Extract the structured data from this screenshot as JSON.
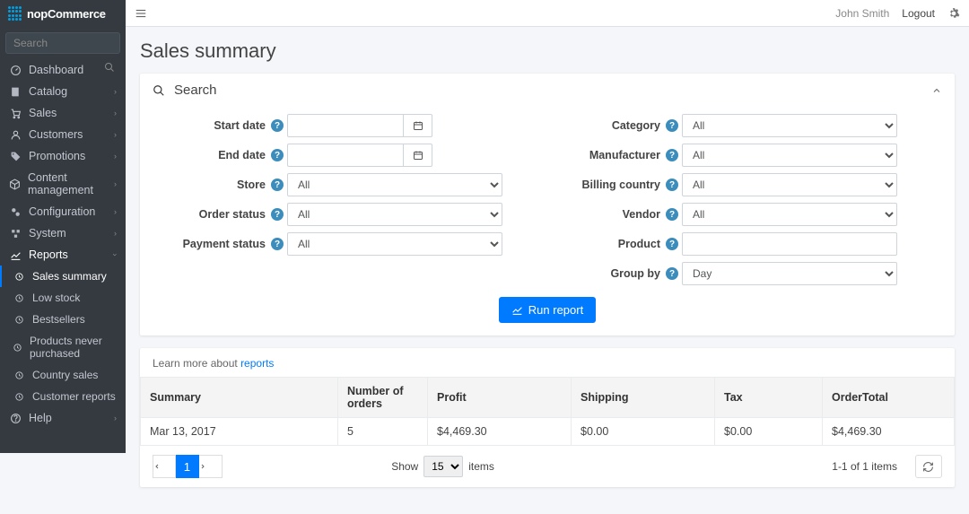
{
  "brand": "nopCommerce",
  "search_placeholder": "Search",
  "user": "John Smith",
  "logout": "Logout",
  "page_title": "Sales summary",
  "sidebar": {
    "items": [
      {
        "label": "Dashboard",
        "icon": "gauge"
      },
      {
        "label": "Catalog",
        "icon": "book",
        "caret": true
      },
      {
        "label": "Sales",
        "icon": "cart",
        "caret": true
      },
      {
        "label": "Customers",
        "icon": "user",
        "caret": true
      },
      {
        "label": "Promotions",
        "icon": "tag",
        "caret": true
      },
      {
        "label": "Content management",
        "icon": "cube",
        "caret": true
      },
      {
        "label": "Configuration",
        "icon": "cogs",
        "caret": true
      },
      {
        "label": "System",
        "icon": "cubes",
        "caret": true
      },
      {
        "label": "Reports",
        "icon": "chart",
        "caret": true,
        "open": true
      },
      {
        "label": "Help",
        "icon": "help",
        "caret": true
      }
    ],
    "reports_sub": [
      {
        "label": "Sales summary",
        "active": true
      },
      {
        "label": "Low stock"
      },
      {
        "label": "Bestsellers"
      },
      {
        "label": "Products never purchased"
      },
      {
        "label": "Country sales"
      },
      {
        "label": "Customer reports"
      }
    ]
  },
  "search_panel": {
    "title": "Search",
    "left": [
      {
        "label": "Start date",
        "type": "date"
      },
      {
        "label": "End date",
        "type": "date"
      },
      {
        "label": "Store",
        "type": "select",
        "value": "All"
      },
      {
        "label": "Order status",
        "type": "select",
        "value": "All"
      },
      {
        "label": "Payment status",
        "type": "select",
        "value": "All"
      }
    ],
    "right": [
      {
        "label": "Category",
        "type": "select",
        "value": "All"
      },
      {
        "label": "Manufacturer",
        "type": "select",
        "value": "All"
      },
      {
        "label": "Billing country",
        "type": "select",
        "value": "All"
      },
      {
        "label": "Vendor",
        "type": "select",
        "value": "All"
      },
      {
        "label": "Product",
        "type": "text",
        "value": ""
      },
      {
        "label": "Group by",
        "type": "select",
        "value": "Day"
      }
    ],
    "run_label": "Run report"
  },
  "report": {
    "learn_prefix": "Learn more about ",
    "learn_link": "reports",
    "columns": [
      "Summary",
      "Number of orders",
      "Profit",
      "Shipping",
      "Tax",
      "OrderTotal"
    ],
    "rows": [
      {
        "summary": "Mar 13, 2017",
        "orders": "5",
        "profit": "$4,469.30",
        "shipping": "$0.00",
        "tax": "$0.00",
        "ordertotal": "$4,469.30"
      }
    ],
    "show_label": "Show",
    "items_label": "items",
    "page_size": "15",
    "page_current": "1",
    "count": "1-1 of 1 items"
  }
}
